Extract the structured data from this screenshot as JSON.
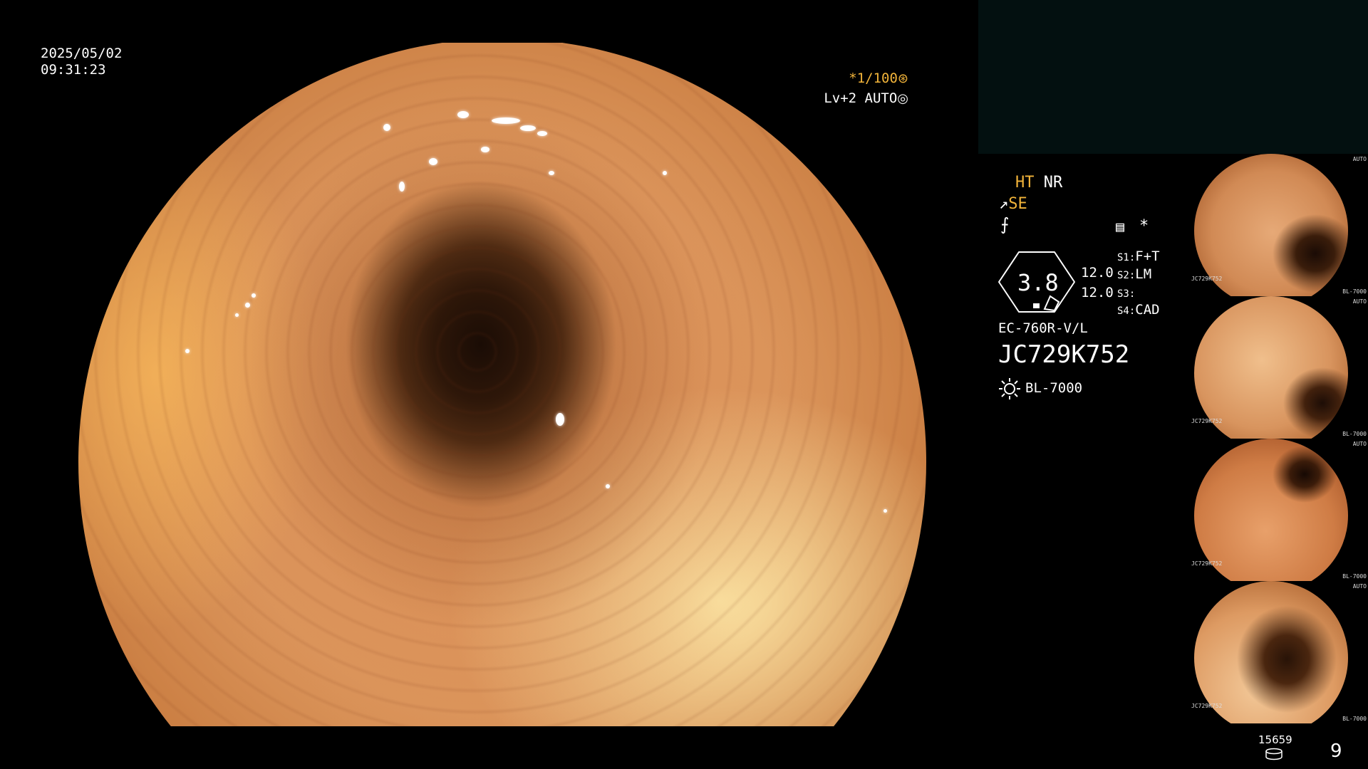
{
  "screen": {
    "date": "2025/05/02",
    "time": "09:31:23"
  },
  "status": {
    "shutter": "*1/100",
    "shutter_icon": "aperture-icon",
    "level": "Lv+2 AUTO",
    "level_icon": "iris-auto-icon"
  },
  "modes": {
    "ht": "HT",
    "nr": "NR",
    "se": "SE",
    "se_icon": "structure-enhance-icon",
    "flat_icon": "color-enhance-icon",
    "memo_icon": "memo-icon",
    "star_icon": "*"
  },
  "gauge": {
    "value": "3.8",
    "row1": "12.0",
    "row2": "12.0"
  },
  "switches": [
    {
      "key": "S1",
      "value": "F+T"
    },
    {
      "key": "S2",
      "value": "LM"
    },
    {
      "key": "S3",
      "value": ""
    },
    {
      "key": "S4",
      "value": "CAD"
    }
  ],
  "device": {
    "model": "EC-760R-V/L",
    "serial": "JC729K752",
    "light_source": "BL-7000",
    "light_icon": "light-source-icon"
  },
  "thumbnails": [
    {
      "id": "JC729K752",
      "light": "BL-7000"
    },
    {
      "id": "JC729K752",
      "light": "BL-7000"
    },
    {
      "id": "JC729K752",
      "light": "BL-7000"
    },
    {
      "id": "JC729K752",
      "light": "BL-7000"
    }
  ],
  "footer": {
    "image_count": "15659",
    "disk_icon": "storage-icon",
    "page": "9"
  },
  "colors": {
    "highlight": "#f2b43a",
    "panel_bg": "#031010"
  }
}
